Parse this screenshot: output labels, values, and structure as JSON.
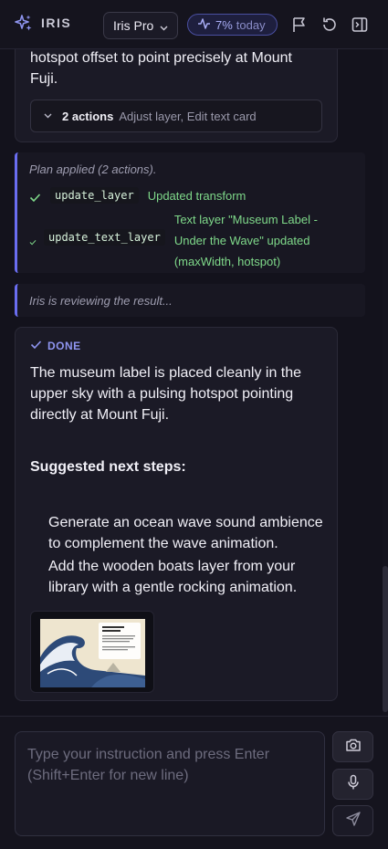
{
  "header": {
    "app_name": "IRIS",
    "model_label": "Iris Pro",
    "usage_percent": "7%",
    "usage_suffix": "today",
    "icons": [
      "sparkle-logo-icon",
      "chevron-down-icon",
      "activity-icon",
      "flag-icon",
      "refresh-icon",
      "collapse-panel-icon"
    ]
  },
  "messages": {
    "prev_text": "hotspot offset to point precisely at Mount Fuji.",
    "actions_count": "2 actions",
    "actions_summary": "Adjust layer, Edit text card",
    "plan": {
      "title": "Plan applied (2 actions).",
      "steps": [
        {
          "tool": "update_layer",
          "result": "Updated transform"
        },
        {
          "tool": "update_text_layer",
          "result": "Text layer \"Museum Label - Under the Wave\" updated (maxWidth, hotspot)"
        }
      ]
    },
    "review_text": "Iris is reviewing the result...",
    "done": {
      "label": "DONE",
      "body": "The museum label is placed cleanly in the upper sky with a pulsing hotspot pointing directly at Mount Fuji.",
      "next_heading": "Suggested next steps:",
      "next_steps": [
        "Generate an ocean wave sound ambience to complement the wave animation.",
        "Add the wooden boats layer from your library with a gentle rocking animation."
      ]
    }
  },
  "composer": {
    "placeholder": "Type your instruction and press Enter (Shift+Enter for new line)",
    "buttons": [
      "camera-icon",
      "microphone-icon",
      "send-icon"
    ]
  },
  "colors": {
    "accent": "#6a6df0",
    "success": "#7fd98a",
    "background": "#13121c"
  }
}
